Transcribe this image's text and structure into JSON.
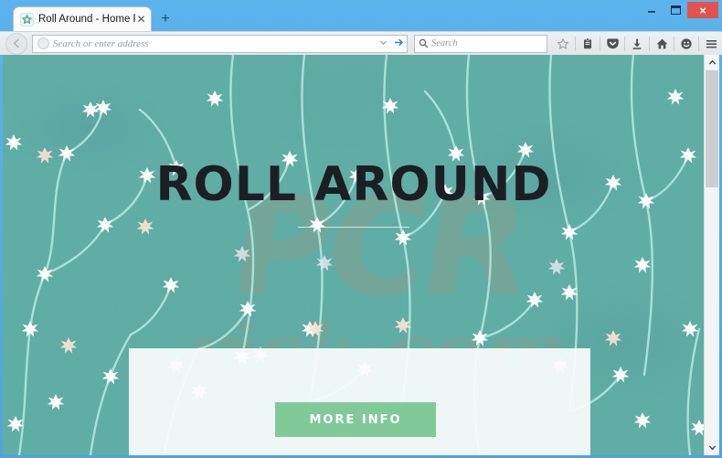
{
  "window": {
    "controls": {
      "minimize": "–",
      "maximize": "❐",
      "close": "×"
    }
  },
  "tabs": {
    "active": {
      "title": "Roll Around - Home Page",
      "favicon": "star-flower-icon",
      "close_label": "✕"
    },
    "new_tab_label": "+"
  },
  "toolbar": {
    "back_label": "←",
    "identity_icon": "globe-icon",
    "address": {
      "value": "",
      "placeholder": "Search or enter address"
    },
    "dropdown_label": "▼",
    "go_label": "→",
    "search": {
      "value": "",
      "placeholder": "Search"
    },
    "icons": [
      {
        "name": "bookmark-star-icon",
        "glyph": "☆"
      },
      {
        "name": "library-clipboard-icon",
        "glyph": "Ὕ0"
      },
      {
        "name": "pocket-icon",
        "glyph": "▼"
      },
      {
        "name": "downloads-icon",
        "glyph": "↓"
      },
      {
        "name": "home-icon",
        "glyph": "⌂"
      },
      {
        "name": "feedback-smiley-icon",
        "glyph": "☺"
      },
      {
        "name": "menu-hamburger-icon",
        "glyph": "☰"
      }
    ]
  },
  "page": {
    "heading": "ROLL AROUND",
    "cta_label": "MORE INFO",
    "watermark": "PCR",
    "watermark_sub": "risk.com",
    "colors": {
      "background_teal": "#60ada5",
      "cta_green": "#82c99a",
      "heading_dark": "#1c1e26",
      "panel_white": "#fafcfc"
    }
  },
  "scrollbar": {
    "up_label": "▲",
    "down_label": "▼"
  }
}
